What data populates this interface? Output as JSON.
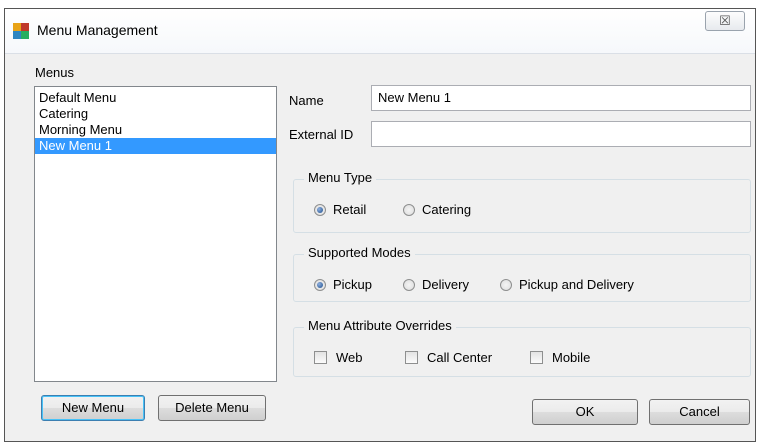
{
  "window": {
    "title": "Menu Management",
    "close_glyph": "☒"
  },
  "menus": {
    "label": "Menus",
    "items": [
      "Default Menu",
      "Catering",
      "Morning Menu",
      "New Menu 1"
    ],
    "selected": "New Menu 1"
  },
  "fields": {
    "name_label": "Name",
    "name_value": "New Menu 1",
    "external_id_label": "External ID",
    "external_id_value": ""
  },
  "menu_type": {
    "title": "Menu Type",
    "options": [
      "Retail",
      "Catering"
    ],
    "selected": "Retail"
  },
  "supported_modes": {
    "title": "Supported Modes",
    "options": [
      "Pickup",
      "Delivery",
      "Pickup and Delivery"
    ],
    "selected": "Pickup"
  },
  "attribute_overrides": {
    "title": "Menu Attribute Overrides",
    "options": [
      {
        "label": "Web",
        "checked": false
      },
      {
        "label": "Call Center",
        "checked": false
      },
      {
        "label": "Mobile",
        "checked": false
      }
    ]
  },
  "buttons": {
    "new_menu": "New Menu",
    "delete_menu": "Delete Menu",
    "ok": "OK",
    "cancel": "Cancel"
  },
  "colors": {
    "selection": "#3399ff",
    "window_bg": "#f0f0f0"
  },
  "icons": {
    "app": "menu-management-app-icon",
    "close": "close-icon"
  }
}
